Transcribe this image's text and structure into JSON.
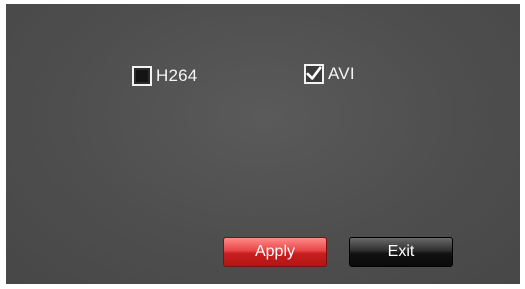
{
  "options": [
    {
      "label": "H264",
      "checked": false
    },
    {
      "label": "AVI",
      "checked": true
    }
  ],
  "buttons": {
    "apply_label": "Apply",
    "exit_label": "Exit"
  },
  "colors": {
    "background": "#4e4e4e",
    "apply": "#e84545",
    "exit": "#121212"
  }
}
